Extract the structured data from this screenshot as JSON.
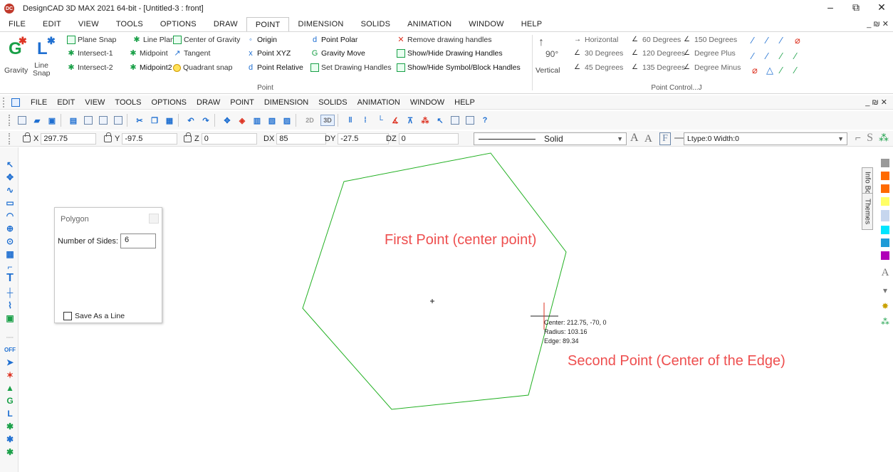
{
  "window": {
    "title": "DesignCAD 3D MAX 2021 64-bit - [Untitled-3 : front]",
    "logo_text": "DC",
    "min": "–",
    "restore": "⧉",
    "close": "✕"
  },
  "ribbon_menu": {
    "items": [
      "FILE",
      "EDIT",
      "VIEW",
      "TOOLS",
      "OPTIONS",
      "DRAW",
      "POINT",
      "DIMENSION",
      "SOLIDS",
      "ANIMATION",
      "WINDOW",
      "HELP"
    ],
    "active": "POINT",
    "mdi": "_ ₪ ✕"
  },
  "ribbon": {
    "point_group": {
      "label": "Point",
      "gravity": "Gravity",
      "line_snap": "Line Snap",
      "plane_snap": "Plane Snap",
      "line_plane": "Line Plane",
      "center_of_gravity": "Center of Gravity",
      "origin": "Origin",
      "point_polar": "Point Polar",
      "remove_handles": "Remove drawing handles",
      "intersect1": "Intersect-1",
      "midpoint": "Midpoint",
      "tangent": "Tangent",
      "point_xyz": "Point XYZ",
      "gravity_move": "Gravity Move",
      "show_hide_handles": "Show/Hide Drawing Handles",
      "intersect2": "Intersect-2",
      "midpoint2": "Midpoint2",
      "quadrant_snap": "Quadrant snap",
      "point_relative": "Point Relative",
      "set_handles": "Set Drawing Handles",
      "show_hide_symbol": "Show/Hide Symbol/Block Handles"
    },
    "point_control_group": {
      "label": "Point Control...J",
      "vertical": "Vertical",
      "deg90": "90°",
      "horizontal": "Horizontal",
      "deg60": "60 Degrees",
      "deg150": "150 Degrees",
      "deg30": "30 Degrees",
      "deg120": "120 Degrees",
      "degree_plus": "Degree Plus",
      "deg45": "45 Degrees",
      "deg135": "135 Degrees",
      "degree_minus": "Degree Minus"
    }
  },
  "menubar2": {
    "items": [
      "FILE",
      "EDIT",
      "VIEW",
      "TOOLS",
      "OPTIONS",
      "DRAW",
      "POINT",
      "DIMENSION",
      "SOLIDS",
      "ANIMATION",
      "WINDOW",
      "HELP"
    ],
    "mdi": "_ ₪ ✕"
  },
  "coords": {
    "x_label": "X",
    "x": "297.75",
    "y_label": "Y",
    "y": "-97.5",
    "z_label": "Z",
    "z": "0",
    "dx_label": "DX",
    "dx": "85",
    "dy_label": "DY",
    "dy": "-27.5",
    "dz_label": "DZ",
    "dz": "0"
  },
  "line_style": "Solid",
  "ltype_width": "Ltype:0 Width:0",
  "toolbar_text": {
    "td2": "2D",
    "td3": "3D",
    "help": "?"
  },
  "dialog": {
    "title": "Polygon",
    "sides_label": "Number of Sides:",
    "sides_value": "6",
    "save_as_line": "Save As a Line"
  },
  "annotations": {
    "first_point": "First Point (center point)",
    "second_point": "Second Point (Center of the Edge)"
  },
  "info": {
    "center": "Center: 212.75, -70, 0",
    "radius": "Radius: 103.16",
    "edge": "Edge: 89.34"
  },
  "right_tabs": {
    "info_box": "Info Box",
    "themes": "Themes"
  },
  "left_tools": {
    "off": "OFF"
  },
  "colors": {
    "polygon": "#22b022",
    "annotation": "#ee4f4f",
    "swatches": [
      "#999999",
      "#ff6a00",
      "#ff6a00",
      "#ffff66",
      "#c6d6ee",
      "#00e5ff",
      "#1e9bd7",
      "#b000b8"
    ]
  }
}
